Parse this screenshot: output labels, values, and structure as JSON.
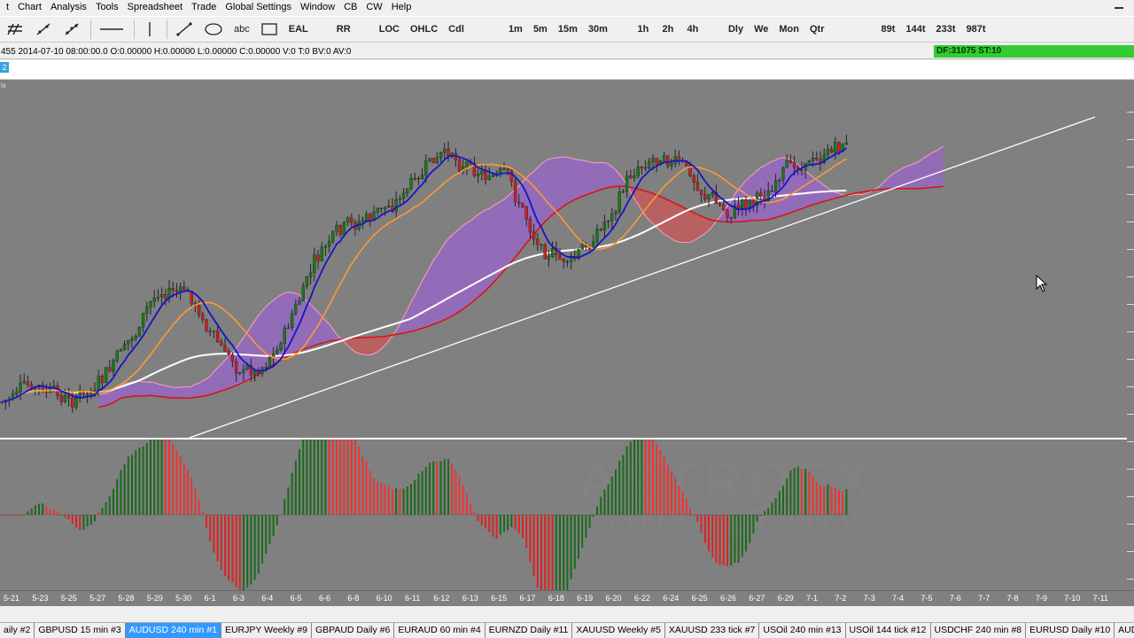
{
  "menu": [
    "t",
    "Chart",
    "Analysis",
    "Tools",
    "Spreadsheet",
    "Trade",
    "Global Settings",
    "Window",
    "CB",
    "CW",
    "Help"
  ],
  "toolbar": {
    "text_tool_label": "abc",
    "ea_label": "EAL",
    "rr_label": "RR",
    "loc_label": "LOC",
    "ohlc_label": "OHLC",
    "cdl_label": "Cdl",
    "timeframes_minutes": [
      "1m",
      "5m",
      "15m",
      "30m"
    ],
    "timeframes_hours": [
      "1h",
      "2h",
      "4h"
    ],
    "timeframes_periods": [
      "Dly",
      "We",
      "Mon",
      "Qtr"
    ],
    "tick_charts": [
      "89t",
      "144t",
      "233t",
      "987t"
    ]
  },
  "infobar": {
    "text": "455  2014-07-10  08:00:00.0  O:0.00000  H:0.00000  L:0.00000  C:0.00000  V:0  T:0  BV:0  AV:0",
    "df_badge": "DF:31075  ST:10"
  },
  "window_tab_number": "2",
  "panel_label": "ls",
  "watermark": {
    "line1": "ASTROFX",
    "line2": "CONSULTANTS",
    "line3": "WWW.ASTROFXC.COM"
  },
  "date_axis": [
    "5-21",
    "5-23",
    "5-25",
    "5-27",
    "5-28",
    "5-29",
    "5-30",
    "6-1",
    "6-3",
    "6-4",
    "6-5",
    "6-6",
    "6-8",
    "6-10",
    "6-11",
    "6-12",
    "6-13",
    "6-15",
    "6-17",
    "6-18",
    "6-19",
    "6-20",
    "6-22",
    "6-24",
    "6-25",
    "6-26",
    "6-27",
    "6-29",
    "7-1",
    "7-2",
    "7-3",
    "7-4",
    "7-5",
    "7-6",
    "7-7",
    "7-8",
    "7-9",
    "7-10",
    "7-11"
  ],
  "tabs": [
    {
      "label": "aily  #2",
      "active": false
    },
    {
      "label": "GBPUSD  15 min   #3",
      "active": false
    },
    {
      "label": "AUDUSD  240 min   #1",
      "active": true
    },
    {
      "label": "EURJPY  Weekly  #9",
      "active": false
    },
    {
      "label": "GBPAUD  Daily  #6",
      "active": false
    },
    {
      "label": "EURAUD  60 min   #4",
      "active": false
    },
    {
      "label": "EURNZD  Daily  #11",
      "active": false
    },
    {
      "label": "XAUUSD  Weekly  #5",
      "active": false
    },
    {
      "label": "XAUUSD  233 tick  #7",
      "active": false
    },
    {
      "label": "USOil  240 min   #13",
      "active": false
    },
    {
      "label": "USOil  144 tick  #12",
      "active": false
    },
    {
      "label": "USDCHF  240 min   #8",
      "active": false
    },
    {
      "label": "EURUSD  Daily  #10",
      "active": false
    },
    {
      "label": "AUDUSD  Da",
      "active": false
    }
  ],
  "colors": {
    "chart_bg": "#808080",
    "bull_candle": "#1a7a1a",
    "bear_candle": "#cc2020",
    "cloud_bull": "#9966cc",
    "cloud_bear": "#cc5555",
    "tenkan": "#1515c8",
    "kijun": "#ff9933",
    "sma": "#ffffff",
    "active_tab": "#3399ff",
    "df_badge": "#33cc33"
  },
  "chart_data": {
    "type": "candlestick",
    "symbol_tab": "AUDUSD 240 min",
    "indicators": [
      "ichimoku-cloud",
      "tenkan",
      "kijun",
      "moving-average",
      "trendline",
      "oscillator-histogram"
    ],
    "trend": [
      0.05,
      0.1,
      0.05,
      0.1,
      0.25,
      0.45,
      0.4,
      0.2,
      0.15,
      0.3,
      0.55,
      0.65,
      0.7,
      0.8,
      0.9,
      0.85,
      0.8,
      0.6,
      0.5,
      0.65,
      0.85,
      0.9,
      0.8,
      0.7,
      0.75,
      0.85,
      0.9,
      0.95
    ]
  }
}
